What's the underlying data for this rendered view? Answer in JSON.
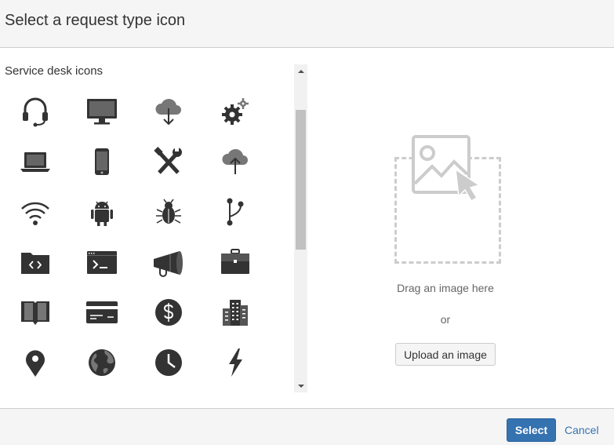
{
  "dialog": {
    "title": "Select a request type icon"
  },
  "icon_panel": {
    "section_label": "Service desk icons",
    "icons": [
      "headset-icon",
      "monitor-icon",
      "cloud-download-icon",
      "gears-icon",
      "laptop-icon",
      "mobile-phone-icon",
      "tools-icon",
      "cloud-upload-icon",
      "wifi-icon",
      "android-icon",
      "bug-icon",
      "git-branch-icon",
      "code-folder-icon",
      "terminal-icon",
      "megaphone-icon",
      "briefcase-icon",
      "book-icon",
      "credit-card-icon",
      "dollar-icon",
      "building-icon",
      "map-pin-icon",
      "globe-icon",
      "clock-icon",
      "lightning-icon"
    ]
  },
  "upload_panel": {
    "drag_text": "Drag an image here",
    "or_text": "or",
    "upload_label": "Upload an image"
  },
  "footer": {
    "select_label": "Select",
    "cancel_label": "Cancel"
  },
  "colors": {
    "icon": "#333333",
    "primary": "#3572b0",
    "placeholder": "#cccccc"
  }
}
